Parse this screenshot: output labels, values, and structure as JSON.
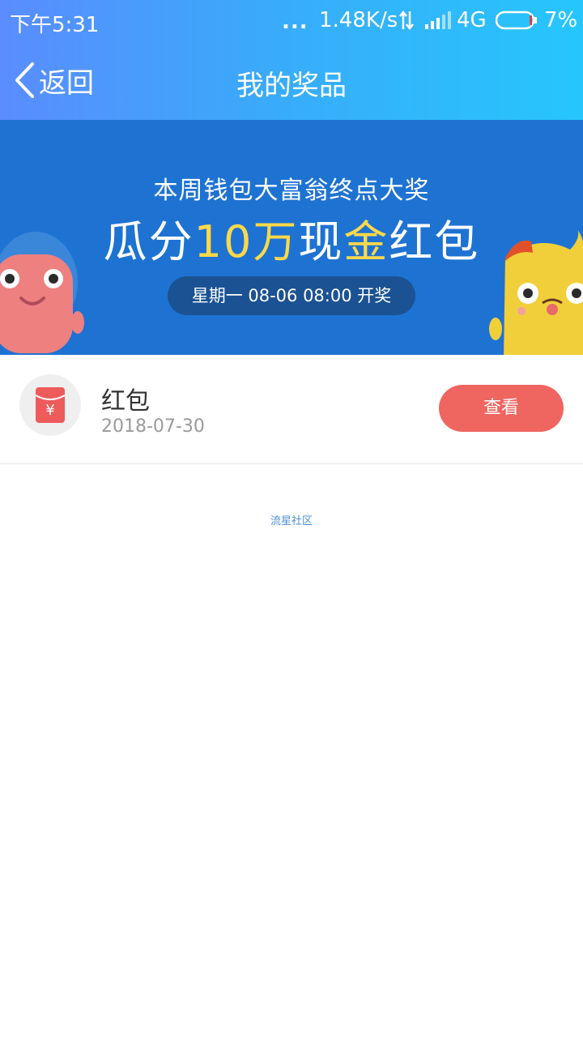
{
  "status_bar": {
    "time": "下午5:31",
    "dots": "...",
    "speed": "1.48K/s",
    "network": "4G",
    "battery_pct": "7%",
    "battery_level": 0.07
  },
  "nav": {
    "back_label": "返回",
    "title": "我的奖品"
  },
  "banner": {
    "subtitle": "本周钱包大富翁终点大奖",
    "main_prefix": "瓜分",
    "main_highlight_1": "10万",
    "main_mid": "现",
    "main_highlight_2": "金",
    "main_suffix": "红包",
    "schedule": "星期一 08-06 08:00 开奖"
  },
  "prize": {
    "name": "红包",
    "date": "2018-07-30",
    "button_label": "查看",
    "icon": "red-envelope-icon",
    "icon_glyph": "¥"
  },
  "watermark": "流星社区",
  "colors": {
    "header_gradient_start": "#5a8cff",
    "header_gradient_end": "#26c6fd",
    "banner_bg": "#1e73d2",
    "highlight_yellow": "#ffd84a",
    "button_red": "#ef6560"
  }
}
